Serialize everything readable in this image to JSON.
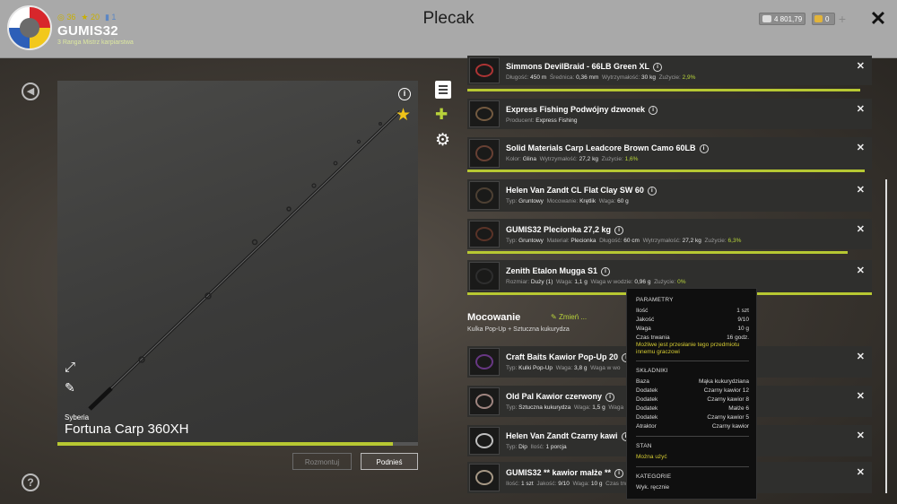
{
  "header": {
    "title": "Plecak",
    "stat_level": "36",
    "stat_stars": "20",
    "stat_blue": "1",
    "username": "GUMIS32",
    "rank": "3 Ranga Mistrz karpiarstwa",
    "money": "4 801,79",
    "gold": "0",
    "plus": "+",
    "close": "✕"
  },
  "preview": {
    "location": "Syberia",
    "item_name": "Fortuna Carp 360XH",
    "progress": 0.93,
    "btn_disassemble": "Rozmontuj",
    "btn_pick": "Podnieś"
  },
  "items": [
    {
      "name": "Simmons DevilBraid - 66LB Green XL",
      "props": [
        [
          "Długość:",
          "450 m"
        ],
        [
          "Średnica:",
          "0,36 mm"
        ],
        [
          "Wytrzymałość:",
          "30 kg"
        ],
        [
          "Zużycie:",
          "2,9%"
        ]
      ],
      "wear": 0.97
    },
    {
      "name": "Express Fishing Podwójny dzwonek",
      "props": [
        [
          "Producent:",
          "Express Fishing"
        ]
      ]
    },
    {
      "name": "Solid Materials Carp Leadcore Brown Camo 60LB",
      "props": [
        [
          "Kolor:",
          "Glina"
        ],
        [
          "Wytrzymałość:",
          "27,2 kg"
        ],
        [
          "Zużycie:",
          "1,6%"
        ]
      ],
      "wear": 0.98
    },
    {
      "name": "Helen Van Zandt CL Flat Clay SW 60",
      "props": [
        [
          "Typ:",
          "Gruntowy"
        ],
        [
          "Mocowanie:",
          "Krętlik"
        ],
        [
          "Waga:",
          "60 g"
        ]
      ]
    },
    {
      "name": "GUMIS32 Plecionka 27,2 kg",
      "props": [
        [
          "Typ:",
          "Gruntowy"
        ],
        [
          "Materiał:",
          "Plecionka"
        ],
        [
          "Długość:",
          "60 cm"
        ],
        [
          "Wytrzymałość:",
          "27,2 kg"
        ],
        [
          "Zużycie:",
          "6,3%"
        ]
      ],
      "wear": 0.94
    },
    {
      "name": "Zenith Etalon Mugga S1",
      "props": [
        [
          "Rozmiar:",
          "Duży (1)"
        ],
        [
          "Waga:",
          "1,1 g"
        ],
        [
          "Waga w wodzie:",
          "0,96 g"
        ],
        [
          "Zużycie:",
          "0%"
        ]
      ],
      "wear": 1.0
    }
  ],
  "mount": {
    "title": "Mocowanie",
    "change": "Zmień ...",
    "subtitle": "Kulka Pop-Up + Sztuczna kukurydza"
  },
  "mount_items": [
    {
      "name": "Craft Baits Kawior Pop-Up 20",
      "props": [
        [
          "Typ:",
          "Kulki Pop-Up"
        ],
        [
          "Waga:",
          "3,8 g"
        ],
        [
          "Waga w wo",
          ""
        ]
      ]
    },
    {
      "name": "Old Pal Kawior czerwony",
      "props": [
        [
          "Typ:",
          "Sztuczna kukurydza"
        ],
        [
          "Waga:",
          "1,5 g"
        ],
        [
          "Waga",
          ""
        ]
      ]
    },
    {
      "name": "Helen Van Zandt Czarny kawi",
      "props": [
        [
          "Typ:",
          "Dip"
        ],
        [
          "Ilość:",
          "1 porcja"
        ]
      ]
    },
    {
      "name": "GUMIS32 ** kawior małże **",
      "props": [
        [
          "Ilość:",
          "1 szt"
        ],
        [
          "Jakość:",
          "9/10"
        ],
        [
          "Waga:",
          "10 g"
        ],
        [
          "Czas trwa",
          ""
        ]
      ]
    }
  ],
  "tooltip": {
    "params_title": "PARAMETRY",
    "params": [
      [
        "Ilość",
        "1 szt"
      ],
      [
        "Jakość",
        "9/10"
      ],
      [
        "Waga",
        "10 g"
      ],
      [
        "Czas trwania",
        "16 godz."
      ]
    ],
    "transfer_note_1": "Możliwe jest przesłanie tego przedmiotu",
    "transfer_note_2": "innemu graczowi",
    "ingredients_title": "SKŁADNIKI",
    "ingredients": [
      [
        "Baza",
        "Mąka kukurydziana"
      ],
      [
        "Dodatek",
        "Czarny kawior 12"
      ],
      [
        "Dodatek",
        "Czarny kawior 8"
      ],
      [
        "Dodatek",
        "Małże 6"
      ],
      [
        "Dodatek",
        "Czarny kawior 5"
      ],
      [
        "Atraktor",
        "Czarny kawior"
      ]
    ],
    "state_title": "STAN",
    "state_value": "Można użyć",
    "category_title": "KATEGORIE",
    "category_value": "Wyk. ręcznie"
  },
  "colors": {
    "accent": "#b8c832",
    "header_bg": "#a9a9a9",
    "tooltip_note": "#d6cc33"
  }
}
